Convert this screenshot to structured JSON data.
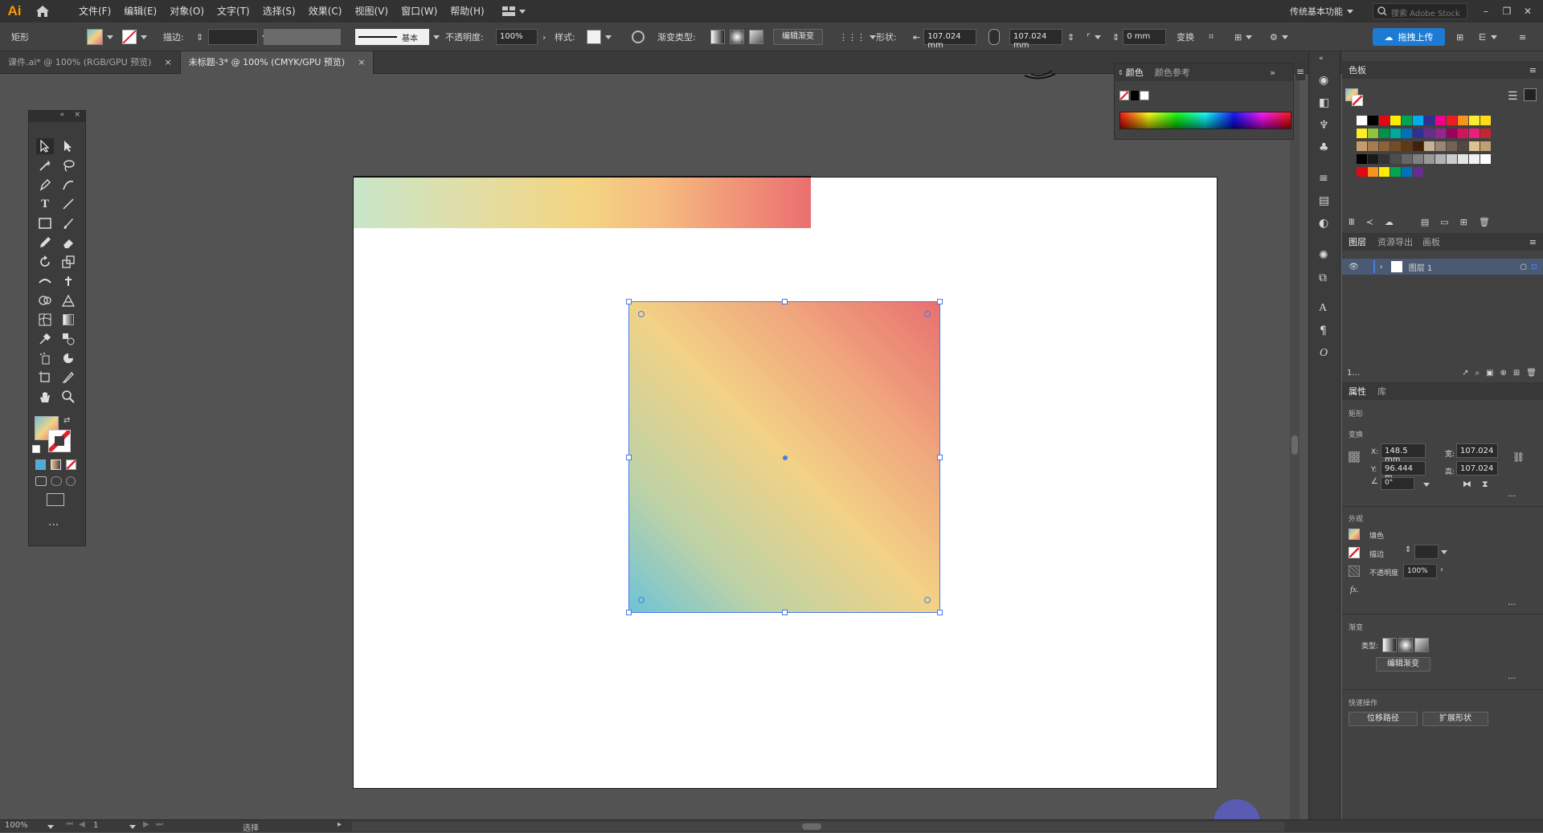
{
  "app": {
    "logo": "Ai",
    "workspace": "传统基本功能",
    "search_placeholder": "搜索 Adobe Stock",
    "upload_label": "拖拽上传"
  },
  "menu": [
    "文件(F)",
    "编辑(E)",
    "对象(O)",
    "文字(T)",
    "选择(S)",
    "效果(C)",
    "视图(V)",
    "窗口(W)",
    "帮助(H)"
  ],
  "control": {
    "object_type": "矩形",
    "stroke_label": "描边:",
    "brush_label": "基本",
    "opacity_label": "不透明度:",
    "opacity_value": "100%",
    "style_label": "样式:",
    "gradient_type_label": "渐变类型:",
    "edit_gradient": "编辑渐变",
    "shape_label": "形状:",
    "width_value": "107.024 mm",
    "height_value": "107.024 mm",
    "corner_value": "0 mm",
    "transform_label": "变换"
  },
  "tabs": [
    {
      "label": "课件.ai* @ 100% (RGB/GPU 预览)",
      "close": "×"
    },
    {
      "label": "未标题-3* @ 100% (CMYK/GPU 预览)",
      "close": "×"
    }
  ],
  "color_panel": {
    "tab1": "颜色",
    "tab2": "颜色参考"
  },
  "swatches_panel": {
    "title": "色板"
  },
  "layers_panel": {
    "tab1": "图层",
    "tab2": "资源导出",
    "tab3": "画板",
    "layer_name": "图层 1",
    "count": "1..."
  },
  "properties": {
    "tab1": "属性",
    "tab2": "库",
    "object_type": "矩形",
    "transform_label": "变换",
    "x_label": "X:",
    "x_value": "148.5 mm",
    "y_label": "Y:",
    "y_value": "96.444 m",
    "w_label": "宽:",
    "w_value": "107.024",
    "h_label": "高:",
    "h_value": "107.024",
    "angle_value": "0°",
    "appearance_label": "外观",
    "fill_label": "填色",
    "stroke_label": "描边",
    "opacity_label": "不透明度",
    "opacity_value": "100%",
    "fx_label": "fx.",
    "gradient_label": "渐变",
    "type_label": "类型:",
    "edit_gradient": "编辑渐变",
    "quick_actions_label": "快速操作",
    "offset_path": "位移路径",
    "expand_shape": "扩展形状"
  },
  "status": {
    "zoom": "100%",
    "artboard_no": "1",
    "mode": "选择"
  },
  "colors": {
    "accent": "#4a7be8",
    "gradient_strip": [
      "#c8e6c9",
      "#f3d583",
      "#f6b97f",
      "#ea6f70"
    ],
    "gradient_square": [
      "#6ec3d8",
      "#f2d285",
      "#e87070"
    ]
  }
}
